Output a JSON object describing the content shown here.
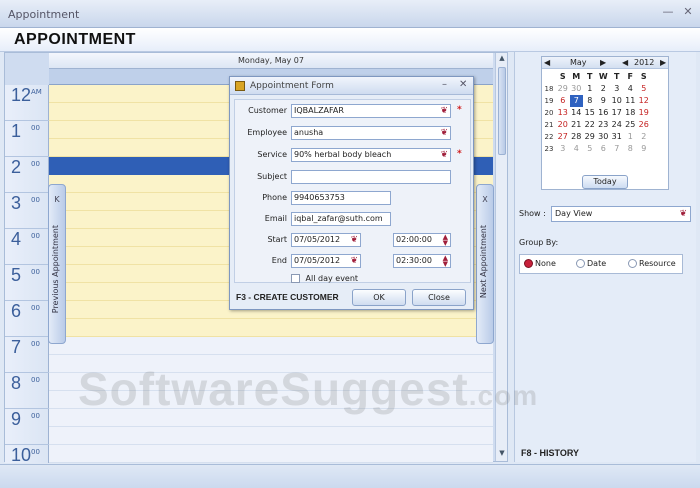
{
  "window": {
    "title": "Appointment"
  },
  "header": {
    "title": "APPOINTMENT"
  },
  "calendar": {
    "day_header": "Monday, May 07",
    "hours": [
      {
        "n": "12",
        "m": "AM"
      },
      {
        "n": "1",
        "m": "00"
      },
      {
        "n": "2",
        "m": "00"
      },
      {
        "n": "3",
        "m": "00"
      },
      {
        "n": "4",
        "m": "00"
      },
      {
        "n": "5",
        "m": "00"
      },
      {
        "n": "6",
        "m": "00"
      },
      {
        "n": "7",
        "m": "00"
      },
      {
        "n": "8",
        "m": "00"
      },
      {
        "n": "9",
        "m": "00"
      },
      {
        "n": "10",
        "m": "00"
      }
    ],
    "previous_tab": "Previous Appointment",
    "previous_glyph": "K",
    "next_tab": "Next Appointment",
    "next_glyph": "X"
  },
  "dialog": {
    "title": "Appointment Form",
    "customer_label": "Customer",
    "customer_value": "IQBALZAFAR",
    "employee_label": "Employee",
    "employee_value": "anusha",
    "service_label": "Service",
    "service_value": "90%  herbal body bleach",
    "subject_label": "Subject",
    "subject_value": "",
    "phone_label": "Phone",
    "phone_value": "9940653753",
    "email_label": "Email",
    "email_value": "iqbal_zafar@suth.com",
    "start_label": "Start",
    "start_date": "07/05/2012",
    "start_time": "02:00:00",
    "end_label": "End",
    "end_date": "07/05/2012",
    "end_time": "02:30:00",
    "allday_label": "All day event",
    "required_mark": "*",
    "footer_hint": "F3 - CREATE CUSTOMER",
    "ok_label": "OK",
    "close_label": "Close"
  },
  "mini_calendar": {
    "month": "May",
    "year": "2012",
    "dow": [
      "S",
      "M",
      "T",
      "W",
      "T",
      "F",
      "S"
    ],
    "weeks": [
      "18",
      "19",
      "20",
      "21",
      "22",
      "23"
    ],
    "rows": [
      [
        "29",
        "30",
        "1",
        "2",
        "3",
        "4",
        "5"
      ],
      [
        "6",
        "7",
        "8",
        "9",
        "10",
        "11",
        "12"
      ],
      [
        "13",
        "14",
        "15",
        "16",
        "17",
        "18",
        "19"
      ],
      [
        "20",
        "21",
        "22",
        "23",
        "24",
        "25",
        "26"
      ],
      [
        "27",
        "28",
        "29",
        "30",
        "31",
        "1",
        "2"
      ],
      [
        "3",
        "4",
        "5",
        "6",
        "7",
        "8",
        "9"
      ]
    ],
    "today_label": "Today"
  },
  "right": {
    "show_label": "Show :",
    "show_value": "Day View",
    "groupby_label": "Group By:",
    "opt_none": "None",
    "opt_date": "Date",
    "opt_resource": "Resource",
    "history_hint": "F8 - HISTORY"
  },
  "watermark": {
    "main": "SoftwareSuggest",
    "suffix": ".com"
  },
  "colors": {
    "accent": "#2f5fb6",
    "required": "#d01e1e",
    "workhours": "#fbf3c9"
  }
}
